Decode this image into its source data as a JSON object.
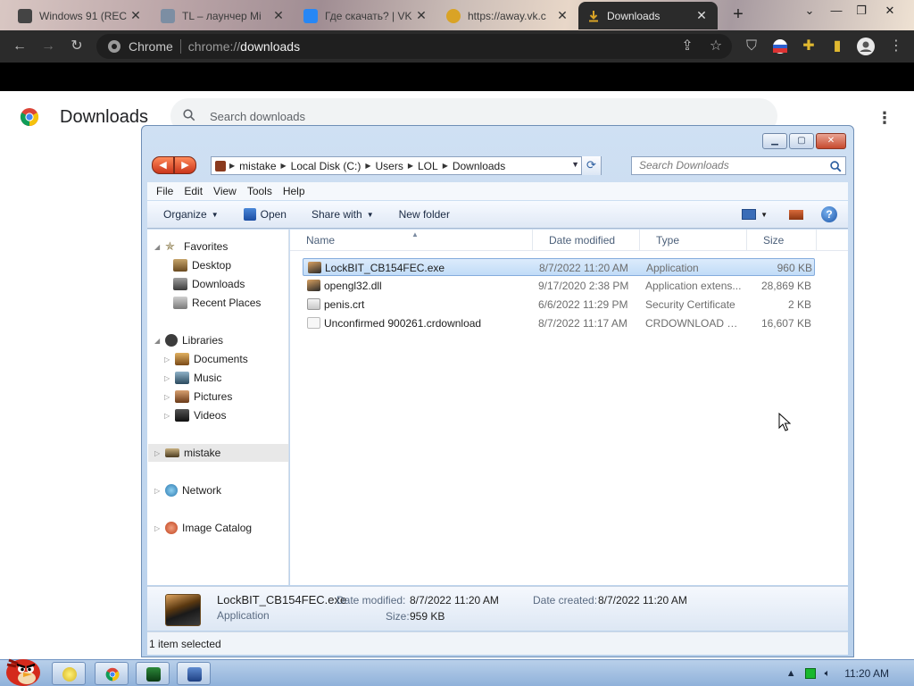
{
  "browser": {
    "tabs": [
      {
        "title": "Windows 91 (REC",
        "active": false
      },
      {
        "title": "TL – лаунчер Mi",
        "active": false
      },
      {
        "title": "Где скачать? | VK",
        "active": false
      },
      {
        "title": "https://away.vk.c",
        "active": false
      },
      {
        "title": "Downloads",
        "active": true
      }
    ],
    "omnibox": {
      "site_label": "Chrome",
      "url_scheme": "chrome://",
      "url_path": "downloads"
    }
  },
  "downloads_page": {
    "title": "Downloads",
    "search_placeholder": "Search downloads"
  },
  "explorer": {
    "breadcrumb": [
      "mistake",
      "Local Disk (C:)",
      "Users",
      "LOL",
      "Downloads"
    ],
    "search_placeholder": "Search Downloads",
    "menu": [
      "File",
      "Edit",
      "View",
      "Tools",
      "Help"
    ],
    "commands": {
      "organize": "Organize",
      "open": "Open",
      "share_with": "Share with",
      "new_folder": "New folder"
    },
    "nav": {
      "favorites": "Favorites",
      "favorites_items": [
        "Desktop",
        "Downloads",
        "Recent Places"
      ],
      "libraries": "Libraries",
      "libraries_items": [
        "Documents",
        "Music",
        "Pictures",
        "Videos"
      ],
      "computer": "mistake",
      "network": "Network",
      "image_catalog": "Image Catalog"
    },
    "columns": [
      "Name",
      "Date modified",
      "Type",
      "Size"
    ],
    "files": [
      {
        "name": "LockBIT_CB154FEC.exe",
        "date": "8/7/2022 11:20 AM",
        "type": "Application",
        "size": "960 KB",
        "selected": true
      },
      {
        "name": "opengl32.dll",
        "date": "9/17/2020 2:38 PM",
        "type": "Application extens...",
        "size": "28,869 KB",
        "selected": false
      },
      {
        "name": "penis.crt",
        "date": "6/6/2022 11:29 PM",
        "type": "Security Certificate",
        "size": "2 KB",
        "selected": false
      },
      {
        "name": "Unconfirmed 900261.crdownload",
        "date": "8/7/2022 11:17 AM",
        "type": "CRDOWNLOAD File",
        "size": "16,607 KB",
        "selected": false
      }
    ],
    "details": {
      "name": "LockBIT_CB154FEC.exe",
      "type": "Application",
      "date_modified_label": "Date modified:",
      "date_modified": "8/7/2022 11:20 AM",
      "size_label": "Size:",
      "size": "959 KB",
      "date_created_label": "Date created:",
      "date_created": "8/7/2022 11:20 AM"
    },
    "status": "1 item selected"
  },
  "taskbar": {
    "clock": "11:20 AM"
  }
}
